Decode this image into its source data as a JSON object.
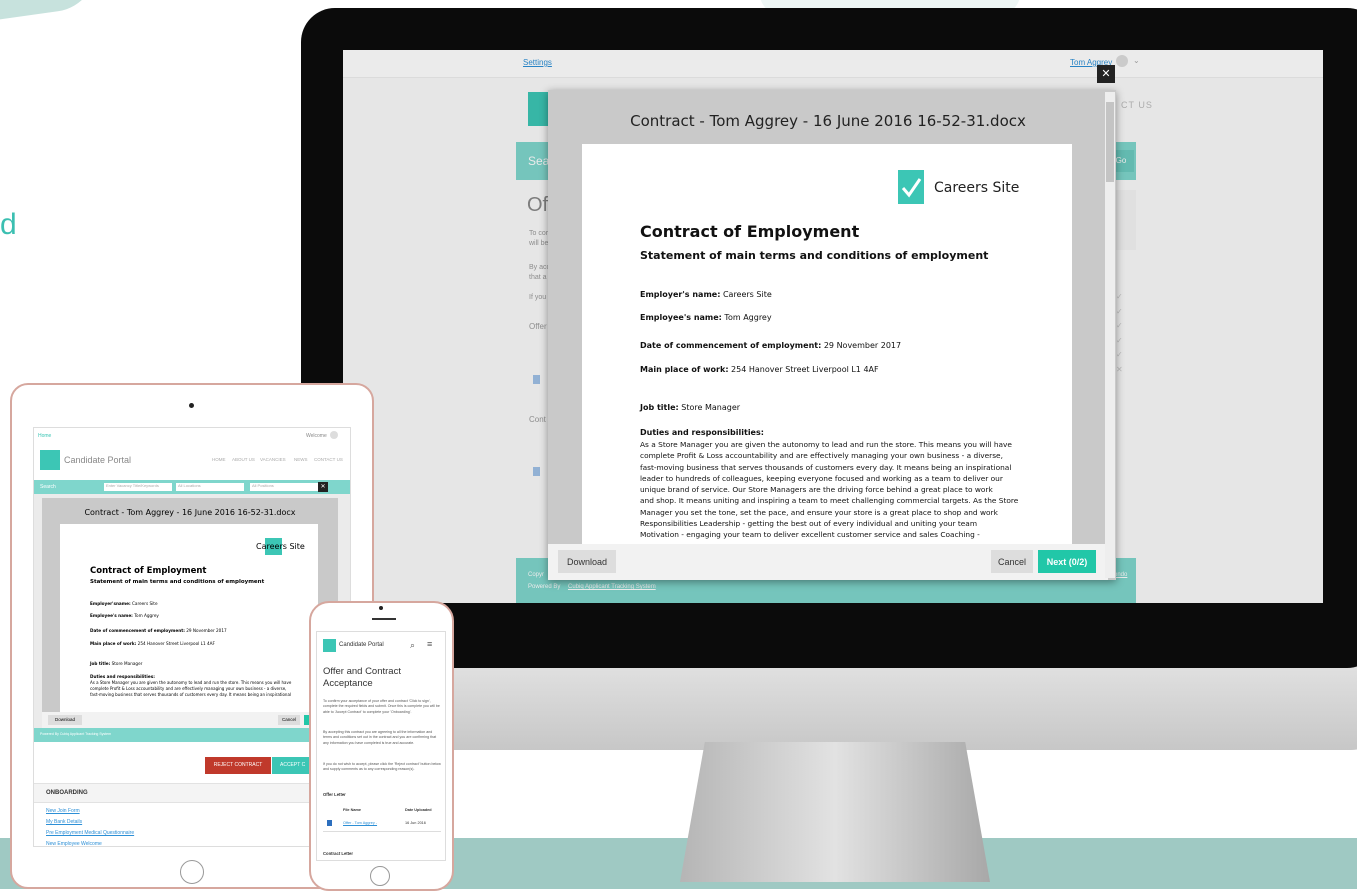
{
  "background": {
    "partial_word": "d"
  },
  "monitor": {
    "header": {
      "settings_link": "Settings",
      "user_name": "Tom Aggrey",
      "nav_fragment": "CT US"
    },
    "page": {
      "search_fragment": "Sea",
      "go_label": "Go",
      "heading_fragment": "Of",
      "para1": "To cor",
      "para1b": "will be",
      "para2": "By acc",
      "para2b": "that a",
      "para3": "If you",
      "offer_fragment": "Offer",
      "contract_fragment": "Cont"
    },
    "footer": {
      "copyright": "Copyr",
      "powered": "Powered By",
      "powered_link": "Cubiq Applicant Tracking System",
      "right_link": "ondo"
    },
    "modal": {
      "title": "Contract - Tom Aggrey - 16 June 2016 16-52-31.docx",
      "brand": "Careers Site",
      "doc_title": "Contract of Employment",
      "doc_subtitle": "Statement of main terms and conditions of employment",
      "fields": [
        {
          "label": "Employer's name:",
          "value": " Careers Site"
        },
        {
          "label": "Employee's name:",
          "value": " Tom Aggrey"
        },
        {
          "label": "Date of commencement of employment:",
          "value": " 29 November 2017"
        },
        {
          "label": "Main place of work:",
          "value": " 254 Hanover Street Liverpool L1 4AF"
        },
        {
          "label": "Job title:",
          "value": " Store Manager"
        }
      ],
      "duties_heading": "Duties and responsibilities:",
      "duties_lines": [
        "As a Store Manager you are given the autonomy to lead and run the store. This means you will have",
        "complete Profit & Loss accountability and are effectively managing your own business - a diverse,",
        "fast-moving business that serves thousands of customers every day. It means being an inspirational",
        "leader to hundreds of colleagues, keeping everyone focused and working as a team to deliver our",
        "unique brand of service.     Our Store Managers are the driving force behind a great place to work",
        "and shop. It means uniting and inspiring a team to meet challenging commercial targets. As the Store",
        "Manager you set the tone, set the pace, and ensure your store is a great place to shop and work",
        "Responsibilities     Leadership - getting the best out of every individual and uniting your team",
        "Motivation - engaging your team to deliver excellent customer service and sales  Coaching -"
      ],
      "download_label": "Download",
      "cancel_label": "Cancel",
      "next_label": "Next (0/2)",
      "close_label": "✕"
    }
  },
  "tablet": {
    "header_left": "Home",
    "header_user": "Welcome",
    "logo": "Candidate Portal",
    "nav": [
      "HOME",
      "ABOUT US",
      "VACANCIES",
      "NEWS",
      "CONTACT US"
    ],
    "search_label": "Search",
    "search_placeholder": "Enter Vacancy Title/Keywords",
    "location_select": "All Locations",
    "position_select": "All Positions",
    "modal_title": "Contract - Tom Aggrey - 16 June 2016 16-52-31.docx",
    "brand": "Careers Site",
    "doc_title": "Contract of Employment",
    "doc_subtitle": "Statement of main terms and conditions of employment",
    "fields": [
      {
        "label": "Employer'sname:",
        "value": " Careers Site"
      },
      {
        "label": "Employee's name:",
        "value": " Tom Aggrey"
      },
      {
        "label": "Date of commencement of employment:",
        "value": " 29 November 2017"
      },
      {
        "label": "Main place of work:",
        "value": " 254 Hanover Street Liverpool L1 4AF"
      },
      {
        "label": "Job title:",
        "value": " Store Manager"
      }
    ],
    "duties_heading": "Duties and responsibilities:",
    "duties_lines": [
      "As a Store Manager you are given the autonomy to lead and run the store. This means you will have",
      "complete Profit & Loss accountability and are effectively managing your own business - a diverse,",
      "fast-moving business that serves thousands of customers every day. It means being an inspirational"
    ],
    "download_label": "Download",
    "cancel_label": "Cancel",
    "powered": "Powered By Cubiq Applicant Tracking System",
    "reject_label": "REJECT CONTRACT",
    "accept_label": "ACCEPT C",
    "onboarding_heading": "ONBOARDING",
    "onboarding_links": [
      "New Join Form",
      "My Bank Details",
      "Pre Employment Medical Questionnaire",
      "New Employee Welcome"
    ]
  },
  "phone": {
    "logo": "Candidate Portal",
    "title_line1": "Offer and Contract",
    "title_line2": "Acceptance",
    "para1": "To confirm your acceptance of your offer and contract 'Click to sign', complete the required fields and submit. Once this is complete you will be able to 'Accept Contract' to complete your 'Onboarding'.",
    "para2": "By accepting this contract you are agreeing to all the information and terms and conditions set out in the contract and you are confirming that any information you have completed is true and accurate.",
    "para3": "If you do not wish to accept, please click the 'Reject contract' button below and supply comments as to any corresponding reason(s).",
    "offer_heading": "Offer Letter",
    "col_file": "File Name",
    "col_date": "Date Uploaded",
    "file_name": "Offer - Tom Aggrey -",
    "file_date": "16 Jun 2016",
    "contract_heading": "Contract Letter"
  },
  "colors": {
    "accent": "#3cc6b5",
    "reject": "#c0392b",
    "teal_band": "#9fc9c3"
  }
}
